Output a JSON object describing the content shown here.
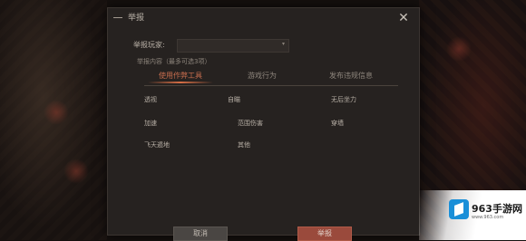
{
  "dialog": {
    "title": "举报",
    "close_glyph": "✕"
  },
  "player": {
    "label": "举报玩家:",
    "value": "",
    "chevron": "▾"
  },
  "content_label": "举报内容（最多可选3项）",
  "tabs": [
    {
      "label": "使用作弊工具",
      "active": true
    },
    {
      "label": "游戏行为",
      "active": false
    },
    {
      "label": "发布违规信息",
      "active": false
    }
  ],
  "options": [
    "透视",
    "自瞄",
    "无后坐力",
    "加速",
    "范围伤害",
    "穿墙",
    "飞天遁地",
    "其他"
  ],
  "hint": "",
  "buttons": {
    "cancel": "取消",
    "report": "举报"
  },
  "brand": {
    "name": "963手游网",
    "url": "www.963.com"
  },
  "colors": {
    "accent": "#c86d4e",
    "report_button": "#9a4a3c",
    "dialog_bg": "#262220"
  }
}
